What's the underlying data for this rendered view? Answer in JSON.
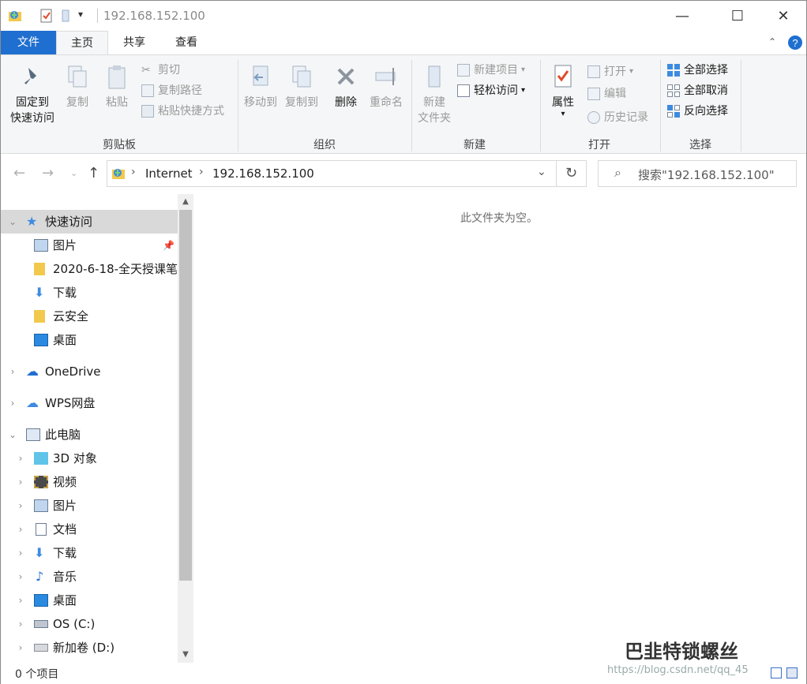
{
  "title_bar": {
    "path": "192.168.152.100",
    "minimize_glyph": "—",
    "maximize_glyph": "☐",
    "close_glyph": "✕",
    "dropdown_glyph": "▾"
  },
  "tabs": [
    {
      "label": "文件"
    },
    {
      "label": "主页"
    },
    {
      "label": "共享"
    },
    {
      "label": "查看"
    }
  ],
  "ribbon": {
    "clipboard": {
      "pin_label_1": "固定到",
      "pin_label_2": "快速访问",
      "copy": "复制",
      "paste": "粘贴",
      "cut": "剪切",
      "copy_path": "复制路径",
      "paste_shortcut": "粘贴快捷方式",
      "group": "剪贴板"
    },
    "organize": {
      "move_to": "移动到",
      "copy_to": "复制到",
      "delete": "删除",
      "rename": "重命名",
      "group": "组织"
    },
    "new": {
      "new_folder_1": "新建",
      "new_folder_2": "文件夹",
      "new_item": "新建项目",
      "easy_access": "轻松访问",
      "group": "新建"
    },
    "open": {
      "properties": "属性",
      "open": "打开",
      "edit": "编辑",
      "history": "历史记录",
      "group": "打开"
    },
    "select": {
      "select_all": "全部选择",
      "select_none": "全部取消",
      "invert": "反向选择",
      "group": "选择"
    }
  },
  "address": {
    "segments": [
      "Internet",
      "192.168.152.100"
    ],
    "search_placeholder": "搜索\"192.168.152.100\""
  },
  "sidebar": {
    "items": [
      {
        "label": "快速访问"
      },
      {
        "label": "图片"
      },
      {
        "label": "2020-6-18-全天授课笔"
      },
      {
        "label": "下载"
      },
      {
        "label": "云安全"
      },
      {
        "label": "桌面"
      },
      {
        "label": "OneDrive"
      },
      {
        "label": "WPS网盘"
      },
      {
        "label": "此电脑"
      },
      {
        "label": "3D 对象"
      },
      {
        "label": "视频"
      },
      {
        "label": "图片"
      },
      {
        "label": "文档"
      },
      {
        "label": "下载"
      },
      {
        "label": "音乐"
      },
      {
        "label": "桌面"
      },
      {
        "label": "OS (C:)"
      },
      {
        "label": "新加卷 (D:)"
      }
    ]
  },
  "content": {
    "empty_message": "此文件夹为空。"
  },
  "status": {
    "item_count": "0 个项目"
  },
  "watermark": {
    "text": "巴韭特锁螺丝",
    "url": "https://blog.csdn.net/qq_45"
  },
  "colors": {
    "accent": "#1f6fd0",
    "folder": "#f2c94c",
    "selection": "#d9d9d9"
  }
}
